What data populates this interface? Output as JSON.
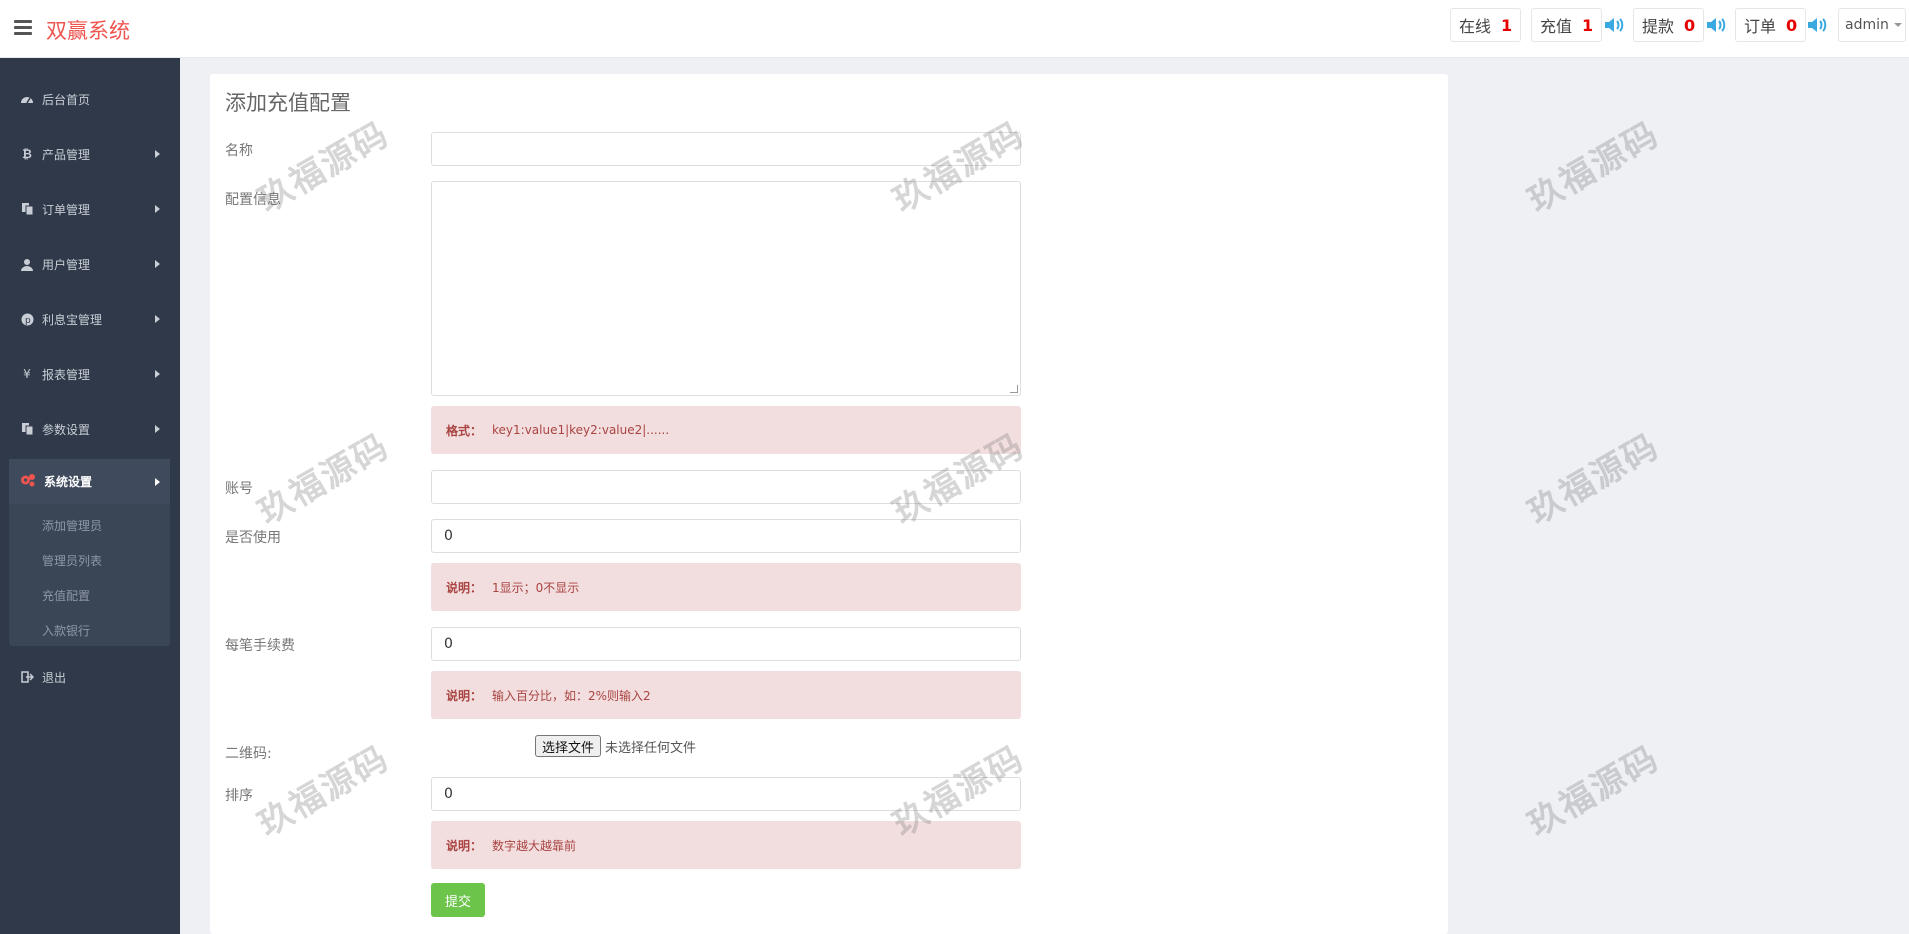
{
  "app": {
    "title": "双赢系统"
  },
  "header": {
    "online": {
      "label": "在线",
      "count": "1"
    },
    "recharge": {
      "label": "充值",
      "count": "1"
    },
    "withdraw": {
      "label": "提款",
      "count": "0"
    },
    "orders": {
      "label": "订单",
      "count": "0"
    },
    "user": "admin"
  },
  "sidebar": {
    "items": [
      {
        "label": "后台首页",
        "icon": "dashboard-icon"
      },
      {
        "label": "产品管理",
        "icon": "bitcoin-icon"
      },
      {
        "label": "订单管理",
        "icon": "copy-icon"
      },
      {
        "label": "用户管理",
        "icon": "user-icon"
      },
      {
        "label": "利息宝管理",
        "icon": "pinterest-icon"
      },
      {
        "label": "报表管理",
        "icon": "yen-icon"
      },
      {
        "label": "参数设置",
        "icon": "copy-icon"
      },
      {
        "label": "系统设置",
        "icon": "cogs-icon"
      },
      {
        "label": "退出",
        "icon": "sign-out-icon"
      }
    ],
    "sub_items": [
      "添加管理员",
      "管理员列表",
      "充值配置",
      "入款银行"
    ]
  },
  "form": {
    "title": "添加充值配置",
    "name_label": "名称",
    "name_value": "",
    "config_label": "配置信息",
    "config_note_key": "格式：",
    "config_note_text": "key1:value1|key2:value2|......",
    "account_label": "账号",
    "account_value": "",
    "enabled_label": "是否使用",
    "enabled_value": "0",
    "enabled_note_key": "说明：",
    "enabled_note_text": "1显示；0不显示",
    "fee_label": "每笔手续费",
    "fee_value": "0",
    "fee_note_key": "说明：",
    "fee_note_text": "输入百分比，如：2%则输入2",
    "qrcode_label": "二维码:",
    "file_button": "选择文件",
    "file_status": "未选择任何文件",
    "sort_label": "排序",
    "sort_value": "0",
    "sort_note_key": "说明：",
    "sort_note_text": "数字越大越靠前",
    "submit_label": "提交"
  },
  "watermark": "玖福源码",
  "colors": {
    "brand": "#f0544f",
    "sidebar": "#2f3949",
    "submit": "#6cc44a",
    "note_bg": "#f2dede",
    "note_text": "#a94442",
    "count": "#e60000",
    "speaker": "#3aa9e0"
  }
}
